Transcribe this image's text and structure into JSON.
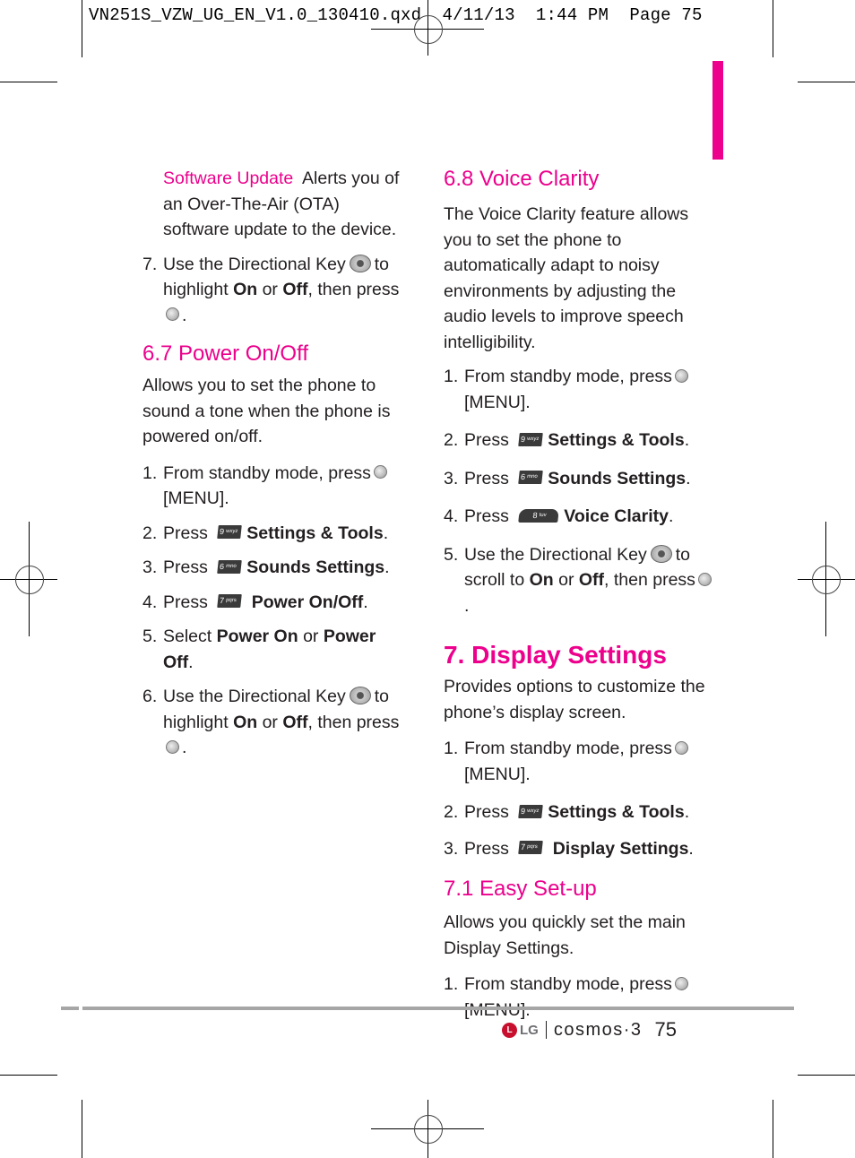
{
  "slug": {
    "file": "VN251S_VZW_UG_EN_V1.0_130410.qxd",
    "date": "4/11/13",
    "time": "1:44 PM",
    "page_label": "Page 75"
  },
  "left": {
    "software_update_term": "Software Update",
    "software_update_desc": "Alerts you of an Over-The-Air (OTA) software update to the device.",
    "step7": {
      "num": "7.",
      "a": "Use the Directional Key",
      "b": "to highlight",
      "on": "On",
      "or": "or",
      "off": "Off",
      "c": ", then press",
      "end": "."
    },
    "power_heading": "6.7 Power On/Off",
    "power_intro": "Allows you to set the phone to sound a tone when the phone is powered on/off.",
    "steps": [
      {
        "num": "1.",
        "pre": "From standby mode, press",
        "post": "[MENU]."
      },
      {
        "num": "2.",
        "pre": "Press",
        "key": "9",
        "key_sub": "wxyz",
        "label": "Settings & Tools",
        "end": "."
      },
      {
        "num": "3.",
        "pre": "Press",
        "key": "6",
        "key_sub": "mno",
        "label": "Sounds Settings",
        "end": "."
      },
      {
        "num": "4.",
        "pre": "Press",
        "key": "7",
        "key_sub": "pqrs",
        "label": "Power On/Off",
        "end": "."
      },
      {
        "num": "5.",
        "pre": "Select",
        "a": "Power On",
        "or": "or",
        "b": "Power Off",
        "end": "."
      },
      {
        "num": "6.",
        "a": "Use the Directional Key",
        "b": "to highlight",
        "on": "On",
        "or": "or",
        "off": "Off",
        "c": ", then press",
        "end": "."
      }
    ]
  },
  "right": {
    "voice_heading": "6.8 Voice Clarity",
    "voice_intro": "The Voice Clarity feature allows you to set the phone to automatically adapt to noisy environments by adjusting the audio levels to improve speech intelligibility.",
    "voice_steps": [
      {
        "num": "1.",
        "pre": "From standby mode, press",
        "post": "[MENU]."
      },
      {
        "num": "2.",
        "pre": "Press",
        "key": "9",
        "key_sub": "wxyz",
        "label": "Settings & Tools",
        "end": "."
      },
      {
        "num": "3.",
        "pre": "Press",
        "key": "6",
        "key_sub": "mno",
        "label": "Sounds Settings",
        "end": "."
      },
      {
        "num": "4.",
        "pre": "Press",
        "key": "8",
        "key_sub": "tuv",
        "label": "Voice Clarity",
        "end": "."
      },
      {
        "num": "5.",
        "a": "Use the Directional Key",
        "b": "to scroll to",
        "on": "On",
        "or": "or",
        "off": "Off",
        "c": ", then press",
        "end": "."
      }
    ],
    "display_heading": "7. Display Settings",
    "display_intro": "Provides options to customize the phone’s display screen.",
    "display_steps": [
      {
        "num": "1.",
        "pre": "From standby mode, press",
        "post": "[MENU]."
      },
      {
        "num": "2.",
        "pre": "Press",
        "key": "9",
        "key_sub": "wxyz",
        "label": "Settings & Tools",
        "end": "."
      },
      {
        "num": "3.",
        "pre": "Press",
        "key": "7",
        "key_sub": "pqrs",
        "label": "Display Settings",
        "end": "."
      }
    ],
    "easy_heading": "7.1 Easy Set-up",
    "easy_intro": "Allows you quickly set the main Display Settings.",
    "easy_steps": [
      {
        "num": "1.",
        "pre": "From standby mode, press",
        "post": "[MENU]."
      }
    ]
  },
  "footer": {
    "logo_mark": "L",
    "brand": "LG",
    "product": "cosmos·3",
    "page_number": "75"
  },
  "colors": {
    "accent": "#ec008c",
    "rule": "#a6a6a6",
    "text": "#231f20"
  }
}
